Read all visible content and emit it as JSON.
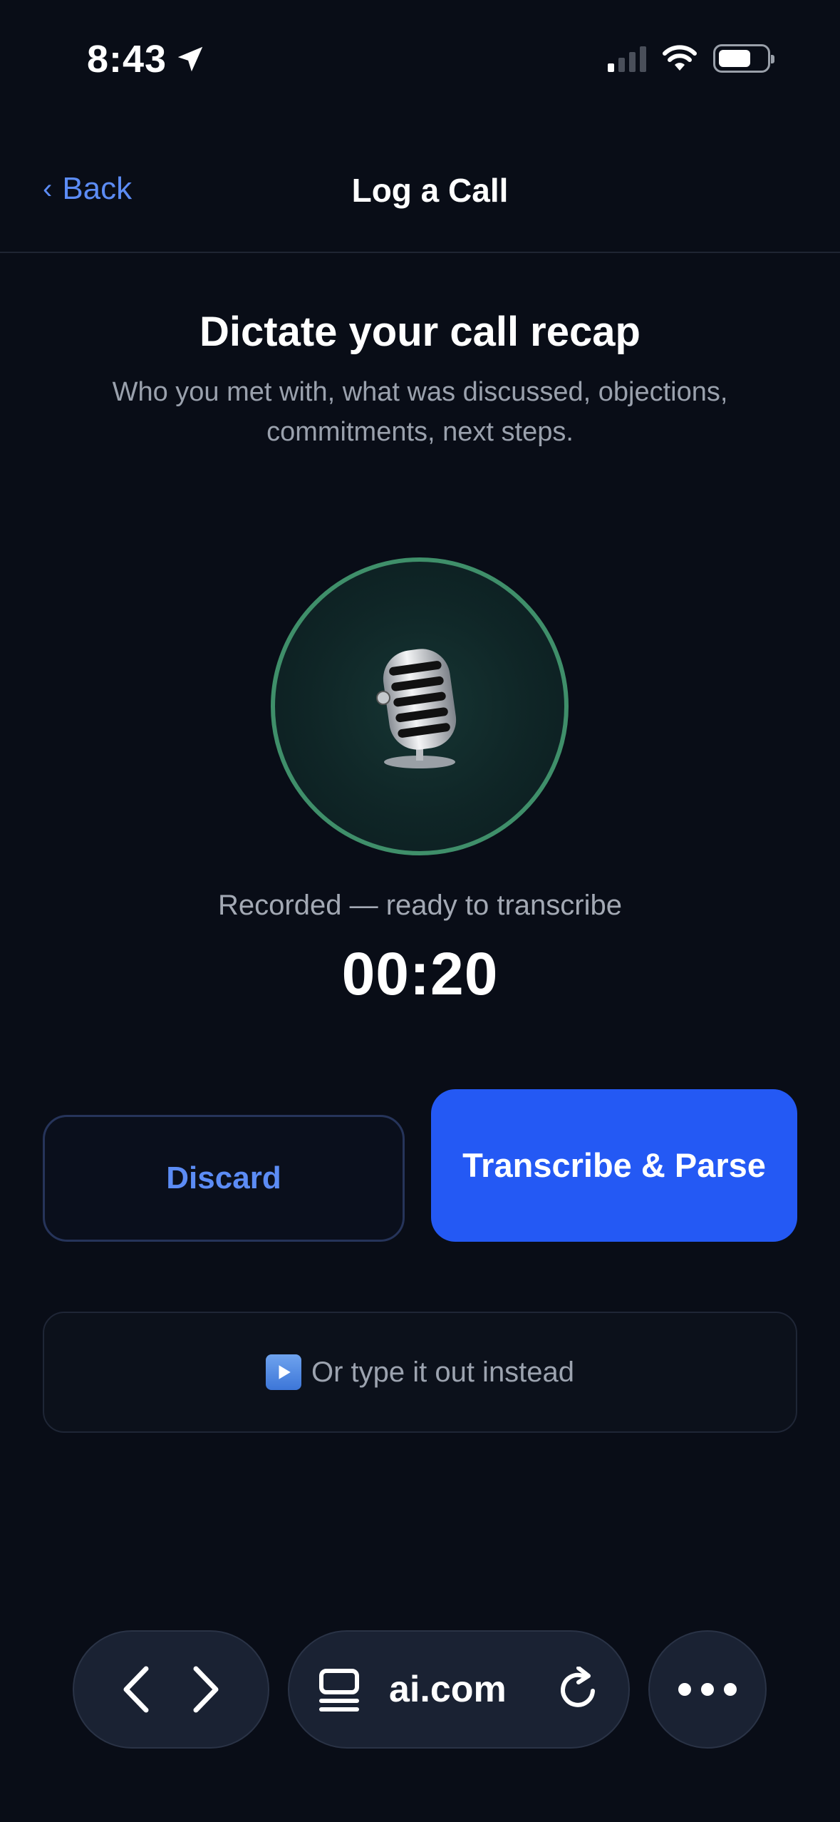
{
  "status_bar": {
    "time": "8:43"
  },
  "header": {
    "back_label": "Back",
    "title": "Log a Call"
  },
  "main": {
    "heading": "Dictate your call recap",
    "subtext": "Who you met with, what was discussed, objections, commitments, next steps.",
    "mic_icon": "microphone-icon",
    "status_text": "Recorded — ready to transcribe",
    "timer": "00:20"
  },
  "actions": {
    "discard_label": "Discard",
    "transcribe_label": "Transcribe & Parse",
    "type_instead_label": "Or type it out instead"
  },
  "browser_bar": {
    "url": "ai.com"
  },
  "colors": {
    "background": "#090d17",
    "accent": "#2459f4",
    "link": "#5c8cf5",
    "mic_ring": "#3f8f6a"
  }
}
